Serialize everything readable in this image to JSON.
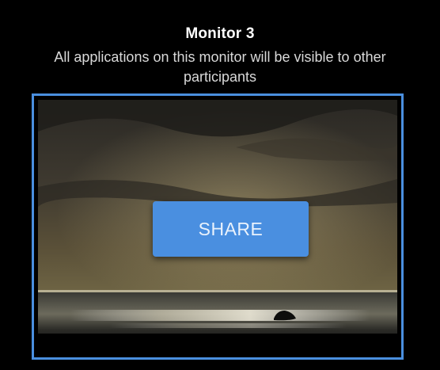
{
  "monitor": {
    "title": "Monitor 3",
    "description": "All applications on this monitor will be visible to other participants"
  },
  "share_button": {
    "label": "SHARE"
  },
  "preview": {
    "image_name": "seascape-wallpaper-thumbnail"
  },
  "colors": {
    "background": "#000000",
    "frame_border": "#4a8fdf",
    "button_bg": "#4a8fe0",
    "title_text": "#ffffff",
    "description_text": "#d9d9d9"
  }
}
